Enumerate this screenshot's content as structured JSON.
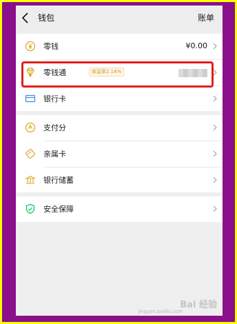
{
  "nav": {
    "title": "钱包",
    "right_label": "账单"
  },
  "groups": [
    {
      "rows": [
        {
          "label": "零钱",
          "value": "¥0.00",
          "icon": "yen-coin-icon"
        },
        {
          "label": "零钱通",
          "badge": "收益率2.18%",
          "value_hidden": true,
          "icon": "diamond-icon"
        },
        {
          "label": "银行卡",
          "icon": "bank-card-icon"
        }
      ]
    },
    {
      "rows": [
        {
          "label": "支付分",
          "icon": "pay-score-icon"
        },
        {
          "label": "亲属卡",
          "icon": "family-card-icon"
        },
        {
          "label": "银行储蓄",
          "icon": "bank-savings-icon"
        }
      ]
    },
    {
      "rows": [
        {
          "label": "安全保障",
          "icon": "shield-icon"
        }
      ]
    }
  ],
  "watermark": {
    "text": "Bai 经验",
    "sub": "jingyan.baidu.com"
  },
  "colors": {
    "frame_yellow": "#ffff00",
    "frame_purple": "#8b0f8a",
    "highlight_red": "#e0201a",
    "icon_green": "#07c160",
    "icon_gold": "#d9a521",
    "icon_blue": "#3a8ee6"
  }
}
